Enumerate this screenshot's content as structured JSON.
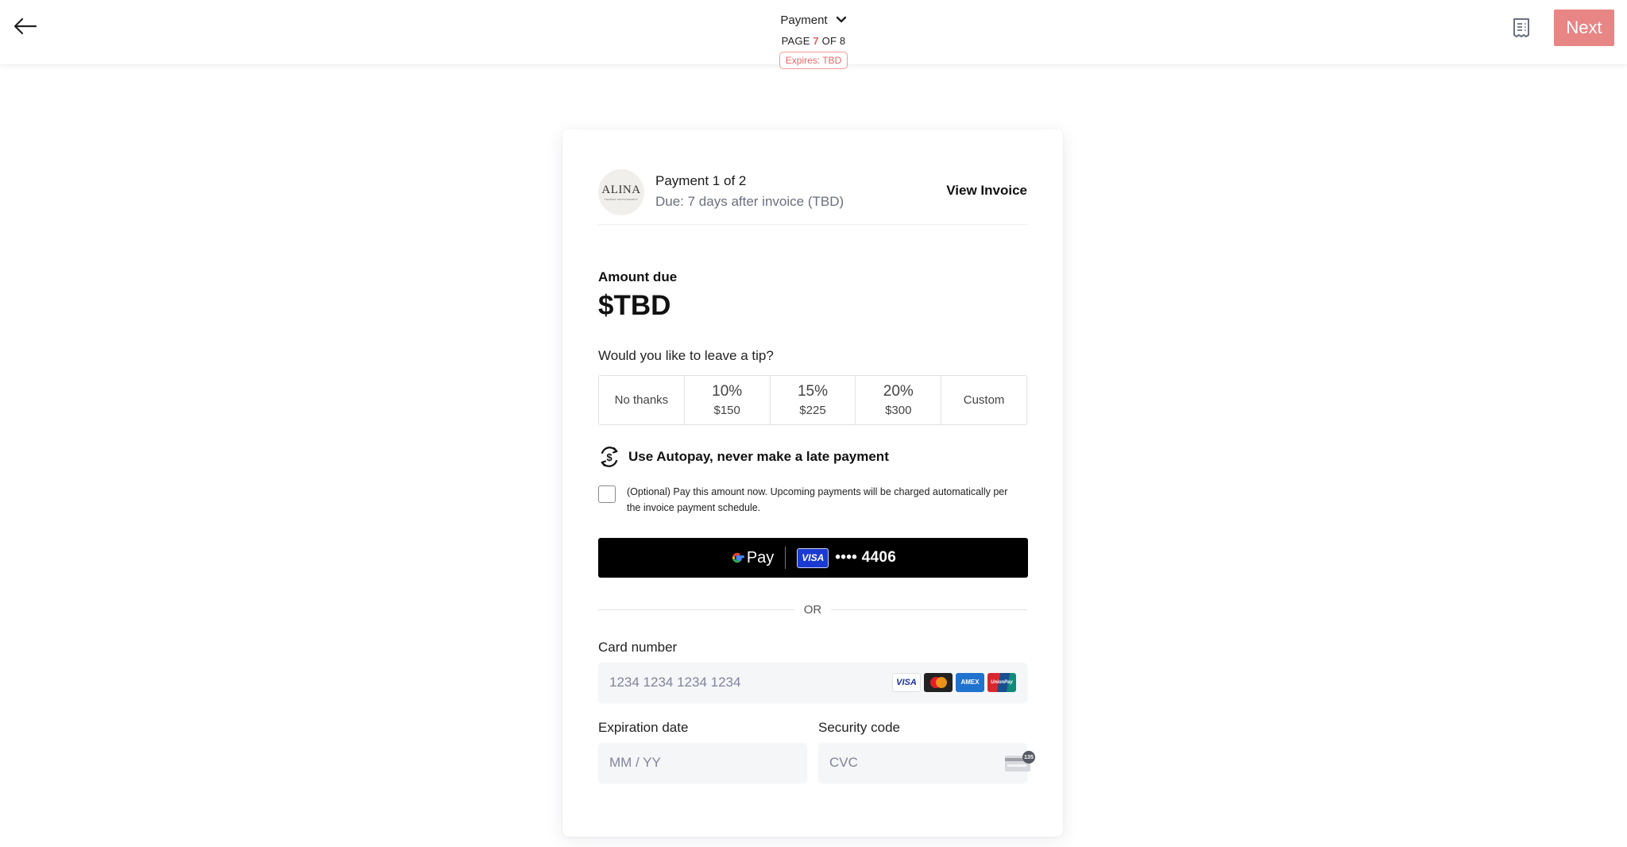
{
  "header": {
    "back_icon": "arrow-left-icon",
    "section_title": "Payment",
    "section_chevron_icon": "chevron-down-icon",
    "page_prefix": "PAGE ",
    "page_current": "7",
    "page_suffix": " OF 8",
    "expires_badge": "Expires: TBD",
    "receipt_icon": "receipt-icon",
    "next_label": "Next"
  },
  "colors": {
    "accent": "#e88585",
    "accent_text": "#e3605e",
    "muted_text": "#6a6f7e",
    "gpay_bg": "#000000"
  },
  "payment": {
    "logo_brand": "ALINA",
    "logo_sub": "THOMAS PHOTOGRAPHY",
    "title": "Payment 1 of 2",
    "due": "Due: 7 days after invoice (TBD)",
    "view_invoice": "View Invoice",
    "amount_label": "Amount due",
    "amount_value": "$TBD"
  },
  "tip": {
    "question": "Would you like to leave a tip?",
    "options": [
      {
        "label": "No thanks"
      },
      {
        "percent": "10%",
        "amount": "$150"
      },
      {
        "percent": "15%",
        "amount": "$225"
      },
      {
        "percent": "20%",
        "amount": "$300"
      },
      {
        "label": "Custom"
      }
    ]
  },
  "autopay": {
    "icon": "autopay-dollar-cycle-icon",
    "title": "Use Autopay, never make a late payment",
    "checkbox_checked": false,
    "description": "(Optional) Pay this amount now. Upcoming payments will be charged automatically per the invoice payment schedule."
  },
  "gpay": {
    "g_letter": "G",
    "pay_label": "Pay",
    "card_brand": "VISA",
    "card_masked": "•••• 4406"
  },
  "divider_text": "OR",
  "card_form": {
    "card_number_label": "Card number",
    "card_number_placeholder": "1234 1234 1234 1234",
    "card_number_value": "",
    "brands": [
      "VISA",
      "Mastercard",
      "AMEX",
      "UnionPay"
    ],
    "expiration_label": "Expiration date",
    "expiration_placeholder": "MM / YY",
    "expiration_value": "",
    "security_label": "Security code",
    "security_placeholder": "CVC",
    "security_value": "",
    "cvc_hint": "135"
  }
}
